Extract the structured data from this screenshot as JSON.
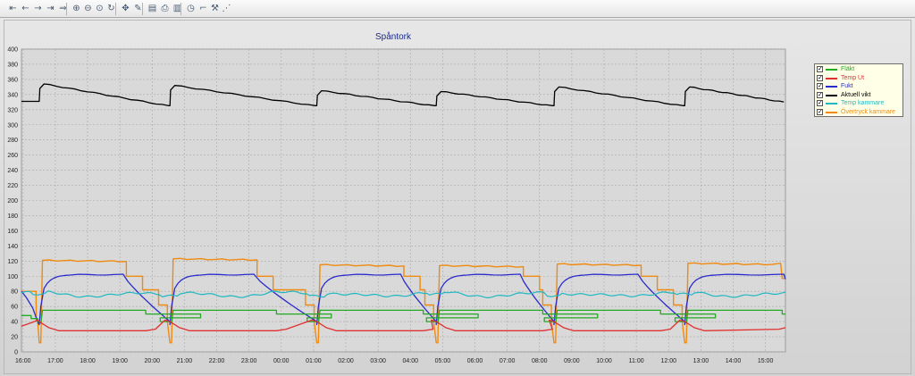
{
  "toolbar": {
    "buttons": [
      {
        "name": "first-page-icon",
        "glyph": "⇤"
      },
      {
        "name": "back-icon",
        "glyph": "←"
      },
      {
        "name": "forward-icon",
        "glyph": "→"
      },
      {
        "name": "last-page-icon",
        "glyph": "⇥"
      },
      {
        "name": "scroll-icon",
        "glyph": "⇒"
      },
      {
        "name": "zoom-in-icon",
        "glyph": "⊕"
      },
      {
        "name": "zoom-out-icon",
        "glyph": "⊖"
      },
      {
        "name": "zoom-fit-icon",
        "glyph": "⊙"
      },
      {
        "name": "refresh-icon",
        "glyph": "↻"
      },
      {
        "name": "pan-icon",
        "glyph": "✥"
      },
      {
        "name": "edit-icon",
        "glyph": "✎"
      },
      {
        "name": "document-icon",
        "glyph": "▤"
      },
      {
        "name": "print-icon",
        "glyph": "⎙"
      },
      {
        "name": "bar-chart-icon",
        "glyph": "▥"
      },
      {
        "name": "timer-icon",
        "glyph": "◷"
      },
      {
        "name": "axis-icon",
        "glyph": "⌐"
      },
      {
        "name": "tools-icon",
        "glyph": "⚒"
      },
      {
        "name": "line-chart-icon",
        "glyph": "⋰"
      }
    ]
  },
  "chart_data": {
    "type": "line",
    "title": "Spåntork",
    "xlabel": "",
    "ylabel": "",
    "xlim_hours": [
      0,
      23.67
    ],
    "x_tick_labels": [
      "16:00",
      "17:00",
      "18:00",
      "19:00",
      "20:00",
      "21:00",
      "22:00",
      "23:00",
      "00:00",
      "01:00",
      "02:00",
      "03:00",
      "04:00",
      "05:00",
      "06:00",
      "07:00",
      "08:00",
      "09:00",
      "10:00",
      "11:00",
      "12:00",
      "13:00",
      "14:00",
      "15:00"
    ],
    "ylim": [
      0,
      400
    ],
    "y_ticks": [
      0,
      20,
      40,
      60,
      80,
      100,
      120,
      140,
      160,
      180,
      200,
      220,
      240,
      260,
      280,
      300,
      320,
      340,
      360,
      380,
      400
    ],
    "grid": true,
    "legend_position": "right",
    "cycle_starts": [
      0.55,
      4.6,
      9.15,
      12.85,
      16.5,
      20.55
    ],
    "series": [
      {
        "name": "Fläkt",
        "color": "#22aa22",
        "key": "flakt",
        "on": 55,
        "off_high": 50,
        "off_low": 40
      },
      {
        "name": "Temp Ut",
        "color": "#e03030",
        "key": "temp",
        "base": 28,
        "peak": 42
      },
      {
        "name": "Fukt",
        "color": "#2a2acc",
        "key": "fukt",
        "plateau": 102,
        "low": 40
      },
      {
        "name": "Aktuell vikt",
        "color": "#000000",
        "key": "vikt",
        "peaks": [
          354,
          352,
          345,
          344,
          350,
          350
        ],
        "end": 330
      },
      {
        "name": "Temp kammare",
        "color": "#20b8c0",
        "key": "tempk",
        "level": 78
      },
      {
        "name": "Övertryck kammare",
        "color": "#f08a10",
        "key": "over",
        "plateaus": [
          121,
          123,
          115,
          114,
          116,
          117
        ],
        "step1": 100,
        "step2": 82,
        "step3": 62
      }
    ]
  }
}
